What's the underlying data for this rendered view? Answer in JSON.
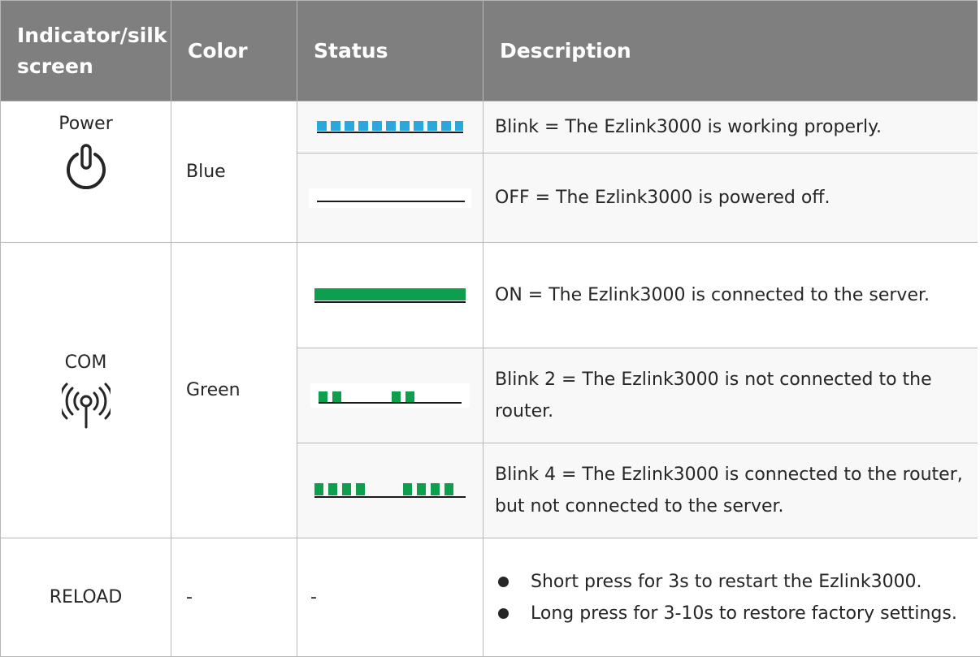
{
  "header": {
    "indicator": "Indicator/silkscreen",
    "color": "Color",
    "status": "Status",
    "description": "Description"
  },
  "rows": {
    "power": {
      "indicator": "Power",
      "icon": "power-icon",
      "color": "Blue",
      "states": [
        {
          "pattern": "blink",
          "led_color": "#2aa7dc",
          "description": "Blink = The Ezlink3000 is working properly."
        },
        {
          "pattern": "off",
          "led_color": "#1a1a1a",
          "description": "OFF = The Ezlink3000 is powered off."
        }
      ]
    },
    "com": {
      "indicator": "COM",
      "icon": "wireless-antenna-icon",
      "color": "Green",
      "states": [
        {
          "pattern": "on",
          "led_color": "#0e9f4e",
          "description": "ON = The Ezlink3000 is connected to the server."
        },
        {
          "pattern": "blink-2",
          "led_color": "#0e9f4e",
          "description": "Blink 2 = The Ezlink3000 is not connected to the router."
        },
        {
          "pattern": "blink-4",
          "led_color": "#0e9f4e",
          "description": "Blink 4 = The Ezlink3000 is connected to the router, but not connected to the server."
        }
      ]
    },
    "reload": {
      "indicator": "RELOAD",
      "color": "-",
      "status": "-",
      "bullets": [
        "Short press for 3s to restart the Ezlink3000.",
        "Long press for 3-10s to restore factory settings."
      ]
    }
  }
}
